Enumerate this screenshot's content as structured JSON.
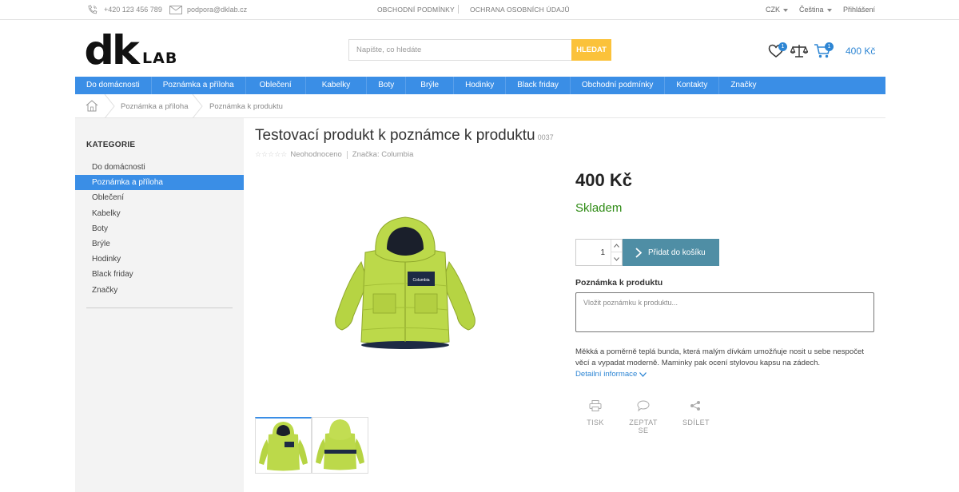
{
  "topbar": {
    "phone": "+420 123 456 789",
    "email": "podpora@dklab.cz",
    "links": [
      "OBCHODNÍ PODMÍNKY",
      "OCHRANA OSOBNÍCH ÚDAJŮ"
    ],
    "currency": "CZK",
    "language": "Čeština",
    "login": "Přihlášení"
  },
  "header": {
    "logo_main": "dk",
    "logo_sub": "LAB",
    "search_placeholder": "Napište, co hledáte",
    "search_button": "HLEDAT",
    "favorites_count": "1",
    "compare_icon": "scales-icon",
    "cart_count": "1",
    "cart_total": "400 Kč"
  },
  "nav": [
    "Do domácnosti",
    "Poznámka a příloha",
    "Oblečení",
    "Kabelky",
    "Boty",
    "Brýle",
    "Hodinky",
    "Black friday",
    "Obchodní podmínky",
    "Kontakty",
    "Značky"
  ],
  "breadcrumb": [
    "Poznámka a příloha",
    "Poznámka k produktu"
  ],
  "sidebar": {
    "heading": "KATEGORIE",
    "items": [
      "Do domácnosti",
      "Poznámka a příloha",
      "Oblečení",
      "Kabelky",
      "Boty",
      "Brýle",
      "Hodinky",
      "Black friday",
      "Značky"
    ],
    "active_index": 1
  },
  "product": {
    "title": "Testovací produkt k poznámce k produktu",
    "code": "0037",
    "rating_text": "Neohodnoceno",
    "brand": "Značka: Columbia",
    "price": "400 Kč",
    "availability": "Skladem",
    "quantity": "1",
    "add_to_cart": "Přidat do košíku",
    "note_label": "Poznámka k produktu",
    "note_placeholder": "Vložit poznámku k produktu...",
    "description": "Měkká a poměrně teplá bunda, která malým dívkám umožňuje nosit u sebe nespočet věcí a vypadat moderně. Maminky pak ocení stylovou kapsu na zádech.",
    "more_info": "Detailní informace",
    "actions": [
      "TISK",
      "ZEPTAT SE",
      "SDÍLET"
    ],
    "jacket_label": "Columbia"
  },
  "colors": {
    "accent_blue": "#3a8ee6",
    "search_button": "#fbc23a",
    "cart_button": "#4f8ea5",
    "stock_green": "#2e8b14",
    "jacket_green": "#bcd94a"
  }
}
